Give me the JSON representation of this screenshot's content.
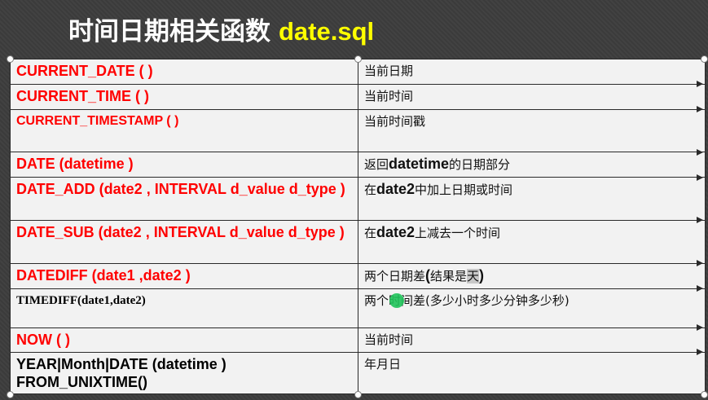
{
  "title": {
    "text": "时间日期相关函数",
    "file": "date.sql"
  },
  "rows": [
    {
      "fn": "CURRENT_DATE (  )",
      "desc": "当前日期"
    },
    {
      "fn": "CURRENT_TIME (  )",
      "desc": "当前时间"
    },
    {
      "fn": "CURRENT_TIMESTAMP ( )",
      "desc": "当前时间戳"
    },
    {
      "fn": "DATE (datetime )",
      "desc_pre": "返回",
      "desc_b": "datetime",
      "desc_post": "的日期部分"
    },
    {
      "fn": "DATE_ADD (date2 , INTERVAL d_value d_type )",
      "desc_pre": "在",
      "desc_b": "date2",
      "desc_post": "中加上日期或时间"
    },
    {
      "fn": "DATE_SUB (date2 , INTERVAL d_value d_type )",
      "desc_pre": "在",
      "desc_b": "date2",
      "desc_post": "上减去一个时间"
    },
    {
      "fn": "DATEDIFF (date1 ,date2 )",
      "desc_pre": "两个日期差",
      "desc_b1": "(",
      "desc_mid": "结果是",
      "desc_hl": "天",
      "desc_b2": ")"
    },
    {
      "fn": "TIMEDIFF(date1,date2)",
      "desc": "两个时间差(多少小时多少分钟多少秒)"
    },
    {
      "fn": "NOW (  )",
      "desc": "当前时间"
    },
    {
      "fn": "YEAR|Month|DATE (datetime ) FROM_UNIXTIME()",
      "desc": "年月日"
    }
  ]
}
